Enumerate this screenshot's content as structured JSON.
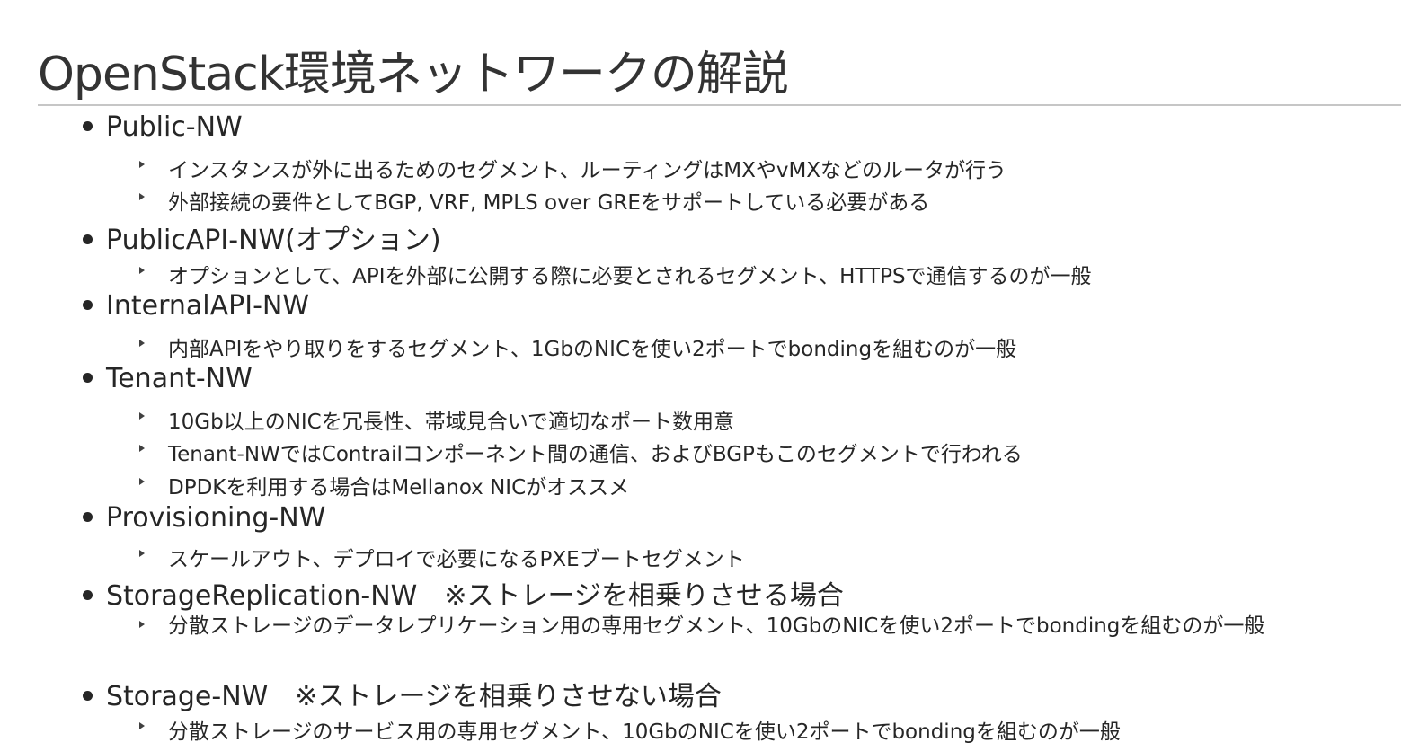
{
  "slide": {
    "title": "OpenStack環境ネットワークの解説",
    "sections": [
      {
        "heading": "Public-NW",
        "items": [
          "インスタンスが外に出るためのセグメント、ルーティングはMXやvMXなどのルータが行う",
          "外部接続の要件としてBGP, VRF, MPLS over GREをサポートしている必要がある"
        ]
      },
      {
        "heading": "PublicAPI-NW(オプション)",
        "items": [
          "オプションとして、APIを外部に公開する際に必要とされるセグメント、HTTPSで通信するのが一般"
        ]
      },
      {
        "heading": "InternalAPI-NW",
        "items": [
          "内部APIをやり取りをするセグメント、1GbのNICを使い2ポートでbondingを組むのが一般"
        ]
      },
      {
        "heading": "Tenant-NW",
        "items": [
          "10Gb以上のNICを冗長性、帯域見合いで適切なポート数用意",
          "Tenant-NWではContrailコンポーネント間の通信、およびBGPもこのセグメントで行われる",
          "DPDKを利用する場合はMellanox NICがオススメ"
        ]
      },
      {
        "heading": "Provisioning-NW",
        "items": [
          "スケールアウト、デプロイで必要になるPXEブートセグメント"
        ]
      },
      {
        "heading": "StorageReplication-NW　※ストレージを相乗りさせる場合",
        "items": [
          "分散ストレージのデータレプリケーション用の専用セグメント、10GbのNICを使い2ポートでbondingを組むのが一般"
        ]
      },
      {
        "heading": "Storage-NW　※ストレージを相乗りさせない場合",
        "items": [
          "分散ストレージのサービス用の専用セグメント、10GbのNICを使い2ポートでbondingを組むのが一般"
        ]
      }
    ]
  }
}
